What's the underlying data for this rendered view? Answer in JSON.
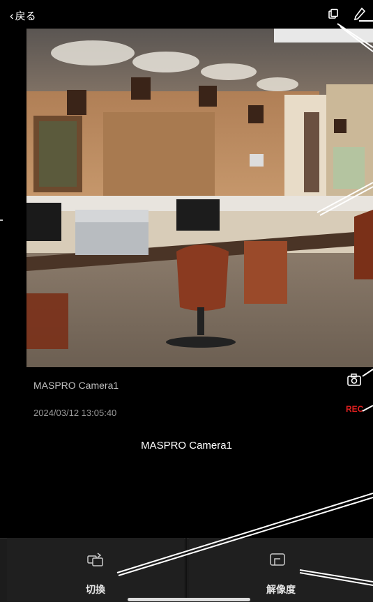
{
  "topbar": {
    "back_label": "戻る"
  },
  "camera": {
    "name": "MASPRO Camera1",
    "timestamp": "2024/03/12 13:05:40",
    "rec_label": "REC",
    "title": "MASPRO Camera1"
  },
  "bottom_buttons": [
    {
      "label": "切換",
      "icon": "switch-camera-icon"
    },
    {
      "label": "解像度",
      "icon": "resolution-icon"
    }
  ],
  "colors": {
    "background": "#000000",
    "rec": "#e02020",
    "bar": "#1f1f1f"
  }
}
